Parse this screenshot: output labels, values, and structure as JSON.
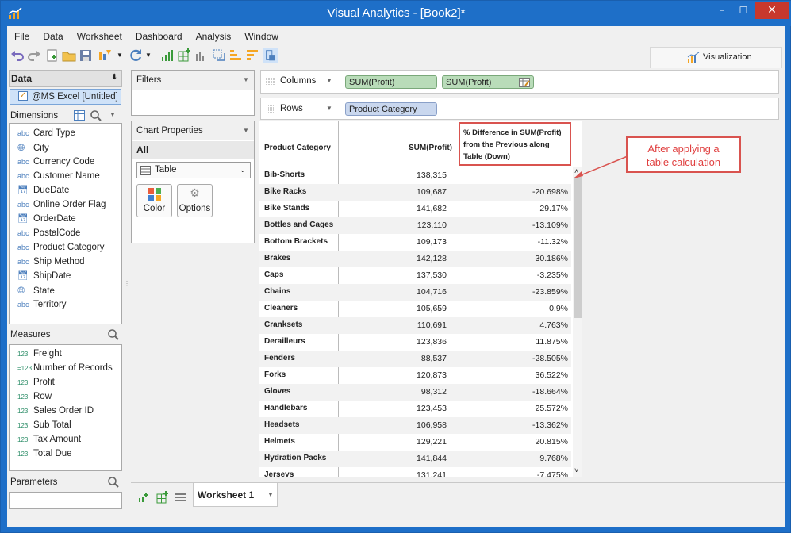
{
  "window": {
    "title": "Visual Analytics - [Book2]*",
    "minimize": "–",
    "maximize": "☐",
    "close": "✕"
  },
  "menu": [
    "File",
    "Data",
    "Worksheet",
    "Dashboard",
    "Analysis",
    "Window"
  ],
  "visualization_tab": "Visualization",
  "data_panel": {
    "title": "Data",
    "source": "@MS Excel [Untitled]",
    "dimensions_label": "Dimensions",
    "dimensions": [
      {
        "type": "abc",
        "name": "Card Type"
      },
      {
        "type": "geo",
        "name": "City"
      },
      {
        "type": "abc",
        "name": "Currency Code"
      },
      {
        "type": "abc",
        "name": "Customer Name"
      },
      {
        "type": "date",
        "name": "DueDate"
      },
      {
        "type": "abc",
        "name": "Online Order Flag"
      },
      {
        "type": "date",
        "name": "OrderDate"
      },
      {
        "type": "abc",
        "name": "PostalCode"
      },
      {
        "type": "abc",
        "name": "Product Category"
      },
      {
        "type": "abc",
        "name": "Ship Method"
      },
      {
        "type": "date",
        "name": "ShipDate"
      },
      {
        "type": "geo",
        "name": "State"
      },
      {
        "type": "abc",
        "name": "Territory"
      }
    ],
    "measures_label": "Measures",
    "measures": [
      {
        "type": "123",
        "name": "Freight"
      },
      {
        "type": "=123",
        "name": "Number of Records"
      },
      {
        "type": "123",
        "name": "Profit"
      },
      {
        "type": "123",
        "name": "Row"
      },
      {
        "type": "123",
        "name": "Sales Order ID"
      },
      {
        "type": "123",
        "name": "Sub Total"
      },
      {
        "type": "123",
        "name": "Tax Amount"
      },
      {
        "type": "123",
        "name": "Total Due"
      }
    ],
    "parameters_label": "Parameters"
  },
  "filters": {
    "title": "Filters"
  },
  "chart_properties": {
    "title": "Chart Properties",
    "scope": "All",
    "chart_type": "Table",
    "color_label": "Color",
    "options_label": "Options"
  },
  "shelves": {
    "columns_label": "Columns",
    "columns_pills": [
      "SUM(Profit)",
      "SUM(Profit)"
    ],
    "rows_label": "Rows",
    "rows_pills": [
      "Product Category"
    ]
  },
  "table": {
    "headers": [
      "Product Category",
      "SUM(Profit)",
      "% Difference in SUM(Profit) from the Previous along Table (Down)"
    ],
    "header_lines": [
      "% Difference in SUM(Profit)",
      "from the Previous along",
      "Table (Down)"
    ],
    "rows": [
      {
        "cat": "Bib-Shorts",
        "profit": "138,315",
        "diff": ""
      },
      {
        "cat": "Bike Racks",
        "profit": "109,687",
        "diff": "-20.698%"
      },
      {
        "cat": "Bike Stands",
        "profit": "141,682",
        "diff": "29.17%"
      },
      {
        "cat": "Bottles and Cages",
        "profit": "123,110",
        "diff": "-13.109%"
      },
      {
        "cat": "Bottom Brackets",
        "profit": "109,173",
        "diff": "-11.32%"
      },
      {
        "cat": "Brakes",
        "profit": "142,128",
        "diff": "30.186%"
      },
      {
        "cat": "Caps",
        "profit": "137,530",
        "diff": "-3.235%"
      },
      {
        "cat": "Chains",
        "profit": "104,716",
        "diff": "-23.859%"
      },
      {
        "cat": "Cleaners",
        "profit": "105,659",
        "diff": "0.9%"
      },
      {
        "cat": "Cranksets",
        "profit": "110,691",
        "diff": "4.763%"
      },
      {
        "cat": "Derailleurs",
        "profit": "123,836",
        "diff": "11.875%"
      },
      {
        "cat": "Fenders",
        "profit": "88,537",
        "diff": "-28.505%"
      },
      {
        "cat": "Forks",
        "profit": "120,873",
        "diff": "36.522%"
      },
      {
        "cat": "Gloves",
        "profit": "98,312",
        "diff": "-18.664%"
      },
      {
        "cat": "Handlebars",
        "profit": "123,453",
        "diff": "25.572%"
      },
      {
        "cat": "Headsets",
        "profit": "106,958",
        "diff": "-13.362%"
      },
      {
        "cat": "Helmets",
        "profit": "129,221",
        "diff": "20.815%"
      },
      {
        "cat": "Hydration Packs",
        "profit": "141,844",
        "diff": "9.768%"
      },
      {
        "cat": "Jerseys",
        "profit": "131,241",
        "diff": "-7.475%"
      }
    ]
  },
  "callout": {
    "line1": "After applying a",
    "line2": "table calculation"
  },
  "sheet_tab": "Worksheet 1"
}
